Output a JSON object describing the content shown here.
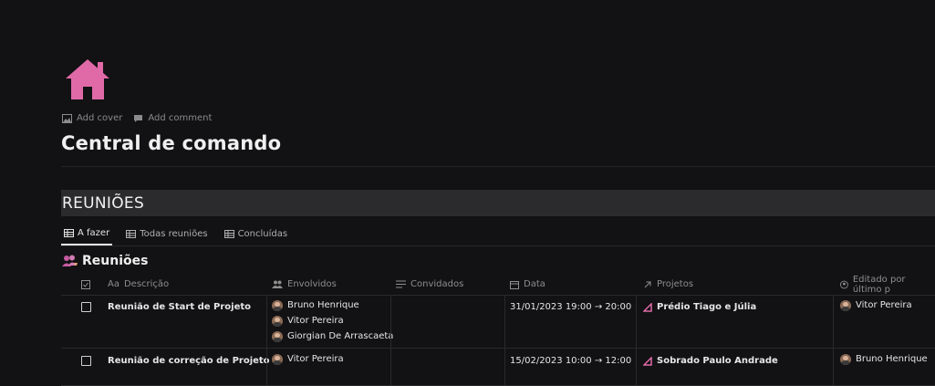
{
  "page": {
    "icon": "house-icon",
    "add_cover": "Add cover",
    "add_comment": "Add comment",
    "title": "Central de comando"
  },
  "section": {
    "title": "REUNIÕES"
  },
  "tabs": [
    {
      "label": "A fazer",
      "icon": "table-icon",
      "active": true
    },
    {
      "label": "Todas reuniões",
      "icon": "table-icon",
      "active": false
    },
    {
      "label": "Concluídas",
      "icon": "table-icon",
      "active": false
    }
  ],
  "database": {
    "title": "Reuniões",
    "icon": "people-icon"
  },
  "columns": {
    "check": "",
    "descricao": "Descrição",
    "descricao_prefix": "Aa",
    "envolvidos": "Envolvidos",
    "convidados": "Convidados",
    "data": "Data",
    "projetos": "Projetos",
    "editado": "Editado por último p"
  },
  "rows": [
    {
      "descricao": "Reunião de Start de Projeto",
      "envolvidos": [
        "Bruno Henrique",
        "Vitor Pereira",
        "Giorgian De Arrascaeta"
      ],
      "convidados": "",
      "data": "31/01/2023 19:00 → 20:00",
      "projeto": "Prédio Tiago e Júlia",
      "editado": "Vitor Pereira"
    },
    {
      "descricao": "Reunião de correção de Projeto",
      "envolvidos": [
        "Vitor Pereira"
      ],
      "convidados": "",
      "data": "15/02/2023 10:00 → 12:00",
      "projeto": "Sobrado Paulo Andrade",
      "editado": "Bruno Henrique"
    }
  ],
  "colors": {
    "accent_pink": "#e06aa8",
    "background": "#121113",
    "header_bar": "#2b2a2d"
  }
}
